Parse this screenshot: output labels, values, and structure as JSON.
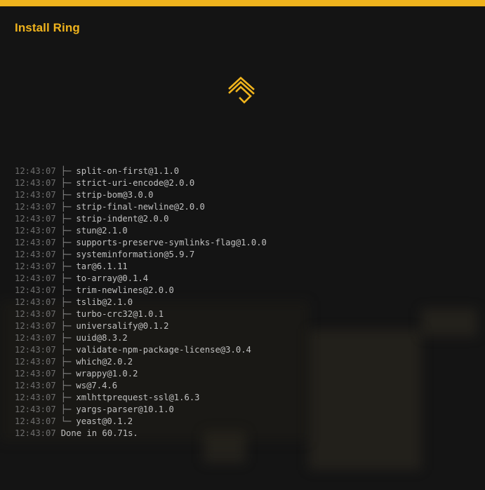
{
  "window": {
    "title": "Install Ring",
    "accent_color": "#efb31d",
    "logo_icon": "ring-logo-icon"
  },
  "log": {
    "lines": [
      {
        "time": "12:43:07",
        "tree": "├─",
        "text": "split-on-first@1.1.0"
      },
      {
        "time": "12:43:07",
        "tree": "├─",
        "text": "strict-uri-encode@2.0.0"
      },
      {
        "time": "12:43:07",
        "tree": "├─",
        "text": "strip-bom@3.0.0"
      },
      {
        "time": "12:43:07",
        "tree": "├─",
        "text": "strip-final-newline@2.0.0"
      },
      {
        "time": "12:43:07",
        "tree": "├─",
        "text": "strip-indent@2.0.0"
      },
      {
        "time": "12:43:07",
        "tree": "├─",
        "text": "stun@2.1.0"
      },
      {
        "time": "12:43:07",
        "tree": "├─",
        "text": "supports-preserve-symlinks-flag@1.0.0"
      },
      {
        "time": "12:43:07",
        "tree": "├─",
        "text": "systeminformation@5.9.7"
      },
      {
        "time": "12:43:07",
        "tree": "├─",
        "text": "tar@6.1.11"
      },
      {
        "time": "12:43:07",
        "tree": "├─",
        "text": "to-array@0.1.4"
      },
      {
        "time": "12:43:07",
        "tree": "├─",
        "text": "trim-newlines@2.0.0"
      },
      {
        "time": "12:43:07",
        "tree": "├─",
        "text": "tslib@2.1.0"
      },
      {
        "time": "12:43:07",
        "tree": "├─",
        "text": "turbo-crc32@1.0.1"
      },
      {
        "time": "12:43:07",
        "tree": "├─",
        "text": "universalify@0.1.2"
      },
      {
        "time": "12:43:07",
        "tree": "├─",
        "text": "uuid@8.3.2"
      },
      {
        "time": "12:43:07",
        "tree": "├─",
        "text": "validate-npm-package-license@3.0.4"
      },
      {
        "time": "12:43:07",
        "tree": "├─",
        "text": "which@2.0.2"
      },
      {
        "time": "12:43:07",
        "tree": "├─",
        "text": "wrappy@1.0.2"
      },
      {
        "time": "12:43:07",
        "tree": "├─",
        "text": "ws@7.4.6"
      },
      {
        "time": "12:43:07",
        "tree": "├─",
        "text": "xmlhttprequest-ssl@1.6.3"
      },
      {
        "time": "12:43:07",
        "tree": "├─",
        "text": "yargs-parser@10.1.0"
      },
      {
        "time": "12:43:07",
        "tree": "└─",
        "text": "yeast@0.1.2"
      }
    ],
    "done": {
      "time": "12:43:07",
      "text": "Done in 60.71s."
    }
  }
}
